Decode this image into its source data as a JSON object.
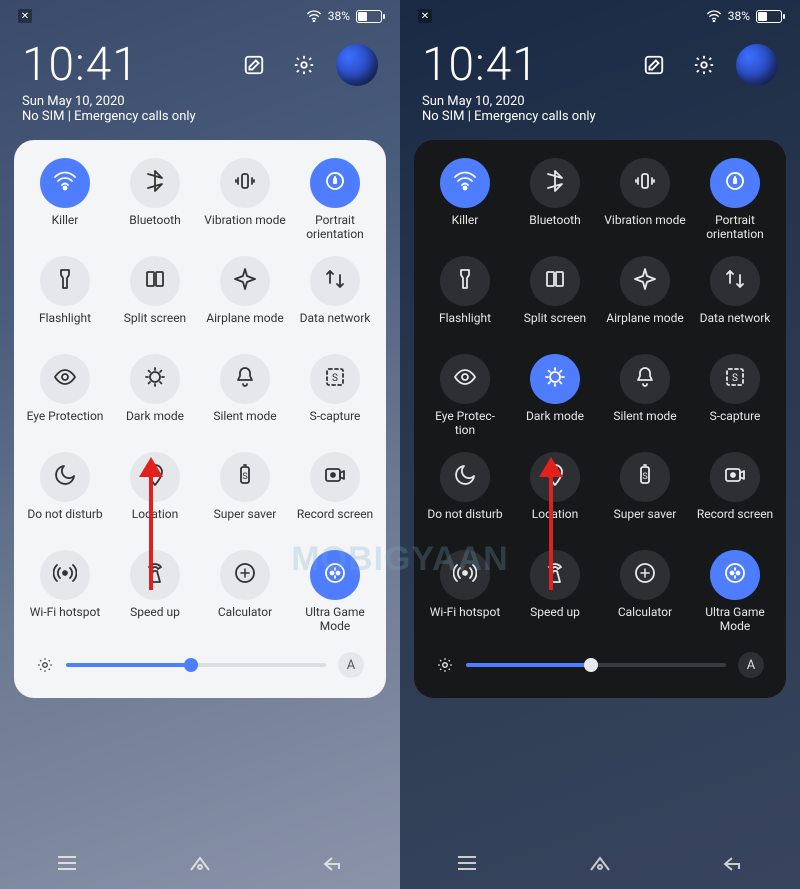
{
  "status": {
    "battery_pct": "38%",
    "x": "✕"
  },
  "header": {
    "time": "10:41",
    "date": "Sun May 10, 2020",
    "sim": "No SIM | Emergency calls only"
  },
  "brightness": {
    "value_pct": 48,
    "auto_label": "A"
  },
  "watermark": "MOBIGYAAN",
  "tiles": [
    {
      "id": "wifi",
      "label": "Killer",
      "on_light": true,
      "on_dark": true
    },
    {
      "id": "bluetooth",
      "label": "Bluetooth",
      "on_light": false,
      "on_dark": false
    },
    {
      "id": "vibration",
      "label": "Vibration mode",
      "on_light": false,
      "on_dark": false
    },
    {
      "id": "portrait",
      "label": "Portrait orientation",
      "on_light": true,
      "on_dark": true
    },
    {
      "id": "flashlight",
      "label": "Flashlight",
      "on_light": false,
      "on_dark": false
    },
    {
      "id": "split",
      "label": "Split screen",
      "on_light": false,
      "on_dark": false
    },
    {
      "id": "airplane",
      "label": "Airplane mode",
      "on_light": false,
      "on_dark": false
    },
    {
      "id": "data",
      "label": "Data network",
      "on_light": false,
      "on_dark": false
    },
    {
      "id": "eye",
      "label_light": "Eye Protection",
      "label_dark": "Eye Protec-\ntion",
      "on_light": false,
      "on_dark": false
    },
    {
      "id": "darkmode",
      "label": "Dark mode",
      "on_light": false,
      "on_dark": true
    },
    {
      "id": "silent",
      "label": "Silent mode",
      "on_light": false,
      "on_dark": false
    },
    {
      "id": "scapture",
      "label": "S-capture",
      "on_light": false,
      "on_dark": false
    },
    {
      "id": "dnd",
      "label": "Do not disturb",
      "on_light": false,
      "on_dark": false
    },
    {
      "id": "location",
      "label": "Location",
      "on_light": false,
      "on_dark": false
    },
    {
      "id": "supersaver",
      "label": "Super saver",
      "on_light": false,
      "on_dark": false
    },
    {
      "id": "record",
      "label": "Record screen",
      "on_light": false,
      "on_dark": false
    },
    {
      "id": "hotspot",
      "label": "Wi-Fi hotspot",
      "on_light": false,
      "on_dark": false
    },
    {
      "id": "speedup",
      "label": "Speed up",
      "on_light": false,
      "on_dark": false
    },
    {
      "id": "calculator",
      "label": "Calculator",
      "on_light": false,
      "on_dark": false
    },
    {
      "id": "game",
      "label": "Ultra Game Mode",
      "on_light": true,
      "on_dark": true
    }
  ]
}
